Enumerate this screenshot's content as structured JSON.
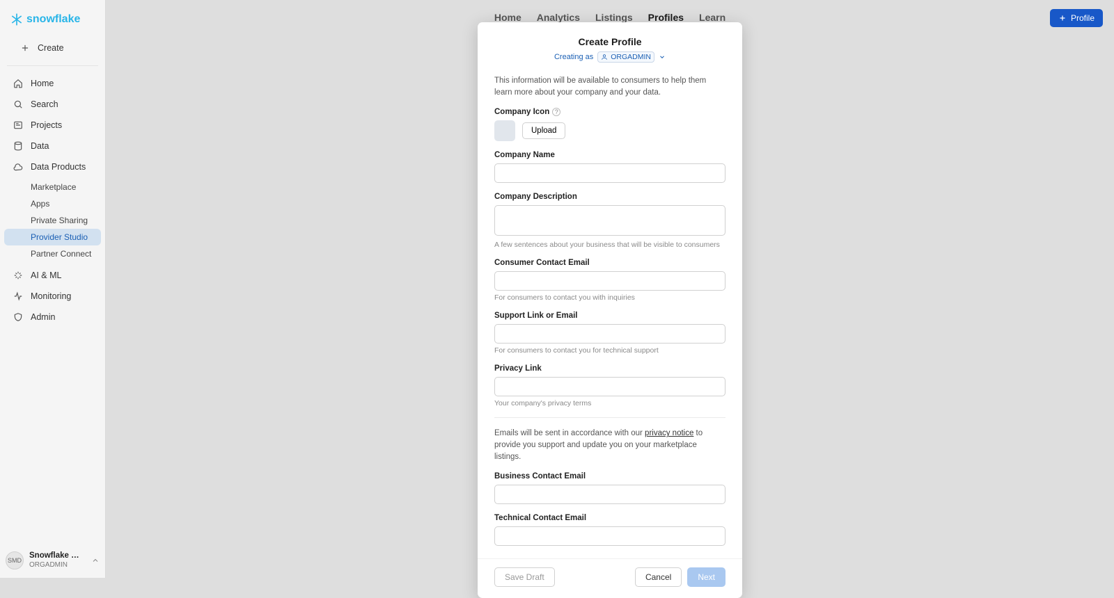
{
  "brand": {
    "name": "snowflake"
  },
  "sidebar": {
    "create": "Create",
    "items": [
      {
        "label": "Home"
      },
      {
        "label": "Search"
      },
      {
        "label": "Projects"
      },
      {
        "label": "Data"
      },
      {
        "label": "Data Products"
      },
      {
        "label": "AI & ML"
      },
      {
        "label": "Monitoring"
      },
      {
        "label": "Admin"
      }
    ],
    "data_products_sub": [
      {
        "label": "Marketplace"
      },
      {
        "label": "Apps"
      },
      {
        "label": "Private Sharing"
      },
      {
        "label": "Provider Studio"
      },
      {
        "label": "Partner Connect"
      }
    ],
    "footer": {
      "initials": "SMD",
      "name": "Snowflake Mark...",
      "role": "ORGADMIN"
    }
  },
  "header": {
    "tabs": [
      {
        "label": "Home"
      },
      {
        "label": "Analytics"
      },
      {
        "label": "Listings"
      },
      {
        "label": "Profiles"
      },
      {
        "label": "Learn"
      }
    ],
    "profile_button": "Profile"
  },
  "modal": {
    "title": "Create Profile",
    "creating_as_label": "Creating as",
    "role": "ORGADMIN",
    "intro": "This information will be available to consumers to help them learn more about your company and your data.",
    "company_icon_label": "Company Icon",
    "upload_button": "Upload",
    "company_name_label": "Company Name",
    "company_name_value": "",
    "company_description_label": "Company Description",
    "company_description_value": "",
    "company_description_help": "A few sentences about your business that will be visible to consumers",
    "consumer_email_label": "Consumer Contact Email",
    "consumer_email_value": "",
    "consumer_email_help": "For consumers to contact you with inquiries",
    "support_label": "Support Link or Email",
    "support_value": "",
    "support_help": "For consumers to contact you for technical support",
    "privacy_label": "Privacy Link",
    "privacy_value": "",
    "privacy_help": "Your company's privacy terms",
    "notice_pre": "Emails will be sent in accordance with our ",
    "notice_link": "privacy notice",
    "notice_post": " to provide you support and update you on your marketplace listings.",
    "business_email_label": "Business Contact Email",
    "business_email_value": "",
    "technical_email_label": "Technical Contact Email",
    "technical_email_value": "",
    "save_draft": "Save Draft",
    "cancel": "Cancel",
    "next": "Next"
  }
}
